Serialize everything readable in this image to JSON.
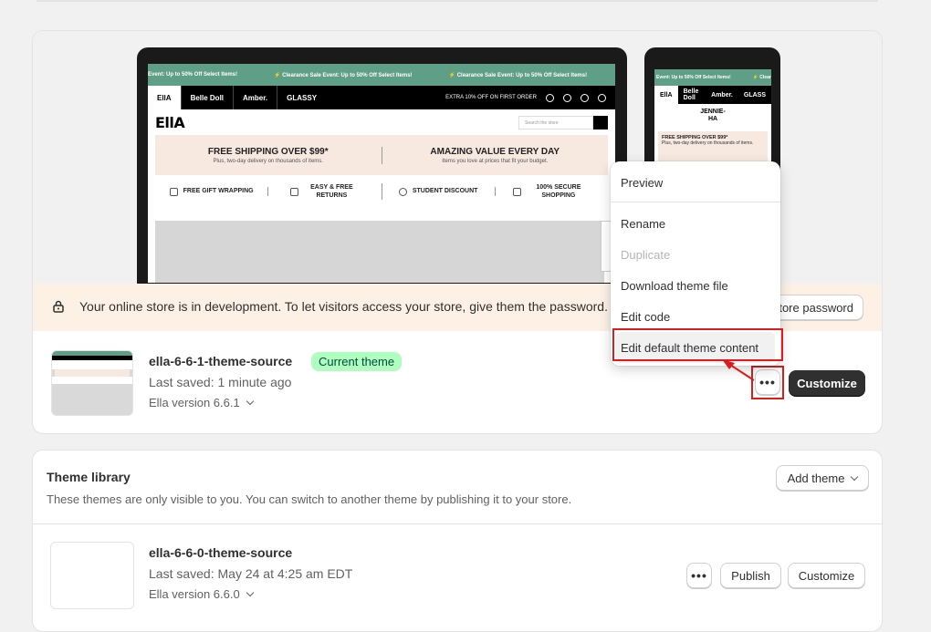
{
  "preview": {
    "announcement": "⚡ Clearance Sale Event: Up to 50% Off Select Items!",
    "announcement_partial": "Event: Up to 50% Off Select Items!",
    "store_tabs": [
      "EllA",
      "Belle Doll",
      "Amber.",
      "GLASSY"
    ],
    "promo_text": "EXTRA 10% OFF ON FIRST ORDER",
    "logo": "EllA",
    "search_placeholder": "Search the store",
    "ship_heading": "FREE SHIPPING OVER $99*",
    "ship_sub": "Plus, two-day delivery on thousands of items.",
    "value_heading": "AMAZING VALUE EVERY DAY",
    "value_sub": "Items you love at prices that fit your budget.",
    "features": [
      "FREE GIFT WRAPPING",
      "EASY & FREE RETURNS",
      "STUDENT DISCOUNT",
      "100% SECURE SHOPPING"
    ],
    "phone_tabs": [
      "EllA",
      "Belle Doll",
      "Amber.",
      "GLASS"
    ],
    "phone_logo": "JENNIE-HA",
    "phone_ship": "FREE SHIPPING OVER $99*",
    "phone_ship_sub": "Plus, two-day delivery on thousands of items."
  },
  "banner": {
    "text": "Your online store is in development. To let visitors access your store, give them the password.",
    "button": "tore password"
  },
  "current_theme": {
    "name": "ella-6-6-1-theme-source",
    "badge": "Current theme",
    "saved": "Last saved: 1 minute ago",
    "version": "Ella version 6.6.1",
    "more": "•••",
    "customize": "Customize"
  },
  "menu": {
    "items": [
      "Preview",
      "Rename",
      "Duplicate",
      "Download theme file",
      "Edit code",
      "Edit default theme content"
    ]
  },
  "library": {
    "title": "Theme library",
    "description": "These themes are only visible to you. You can switch to another theme by publishing it to your store.",
    "add_theme": "Add theme",
    "themes": [
      {
        "name": "ella-6-6-0-theme-source",
        "saved": "Last saved: May 24 at 4:25 am EDT",
        "version": "Ella version 6.6.0",
        "more": "•••",
        "publish": "Publish",
        "customize": "Customize"
      }
    ]
  },
  "colors": {
    "accent_green": "#5f9e87",
    "badge_bg": "#affebf",
    "highlight_red": "#e01b1b",
    "banner_bg": "#fdf1e6"
  }
}
